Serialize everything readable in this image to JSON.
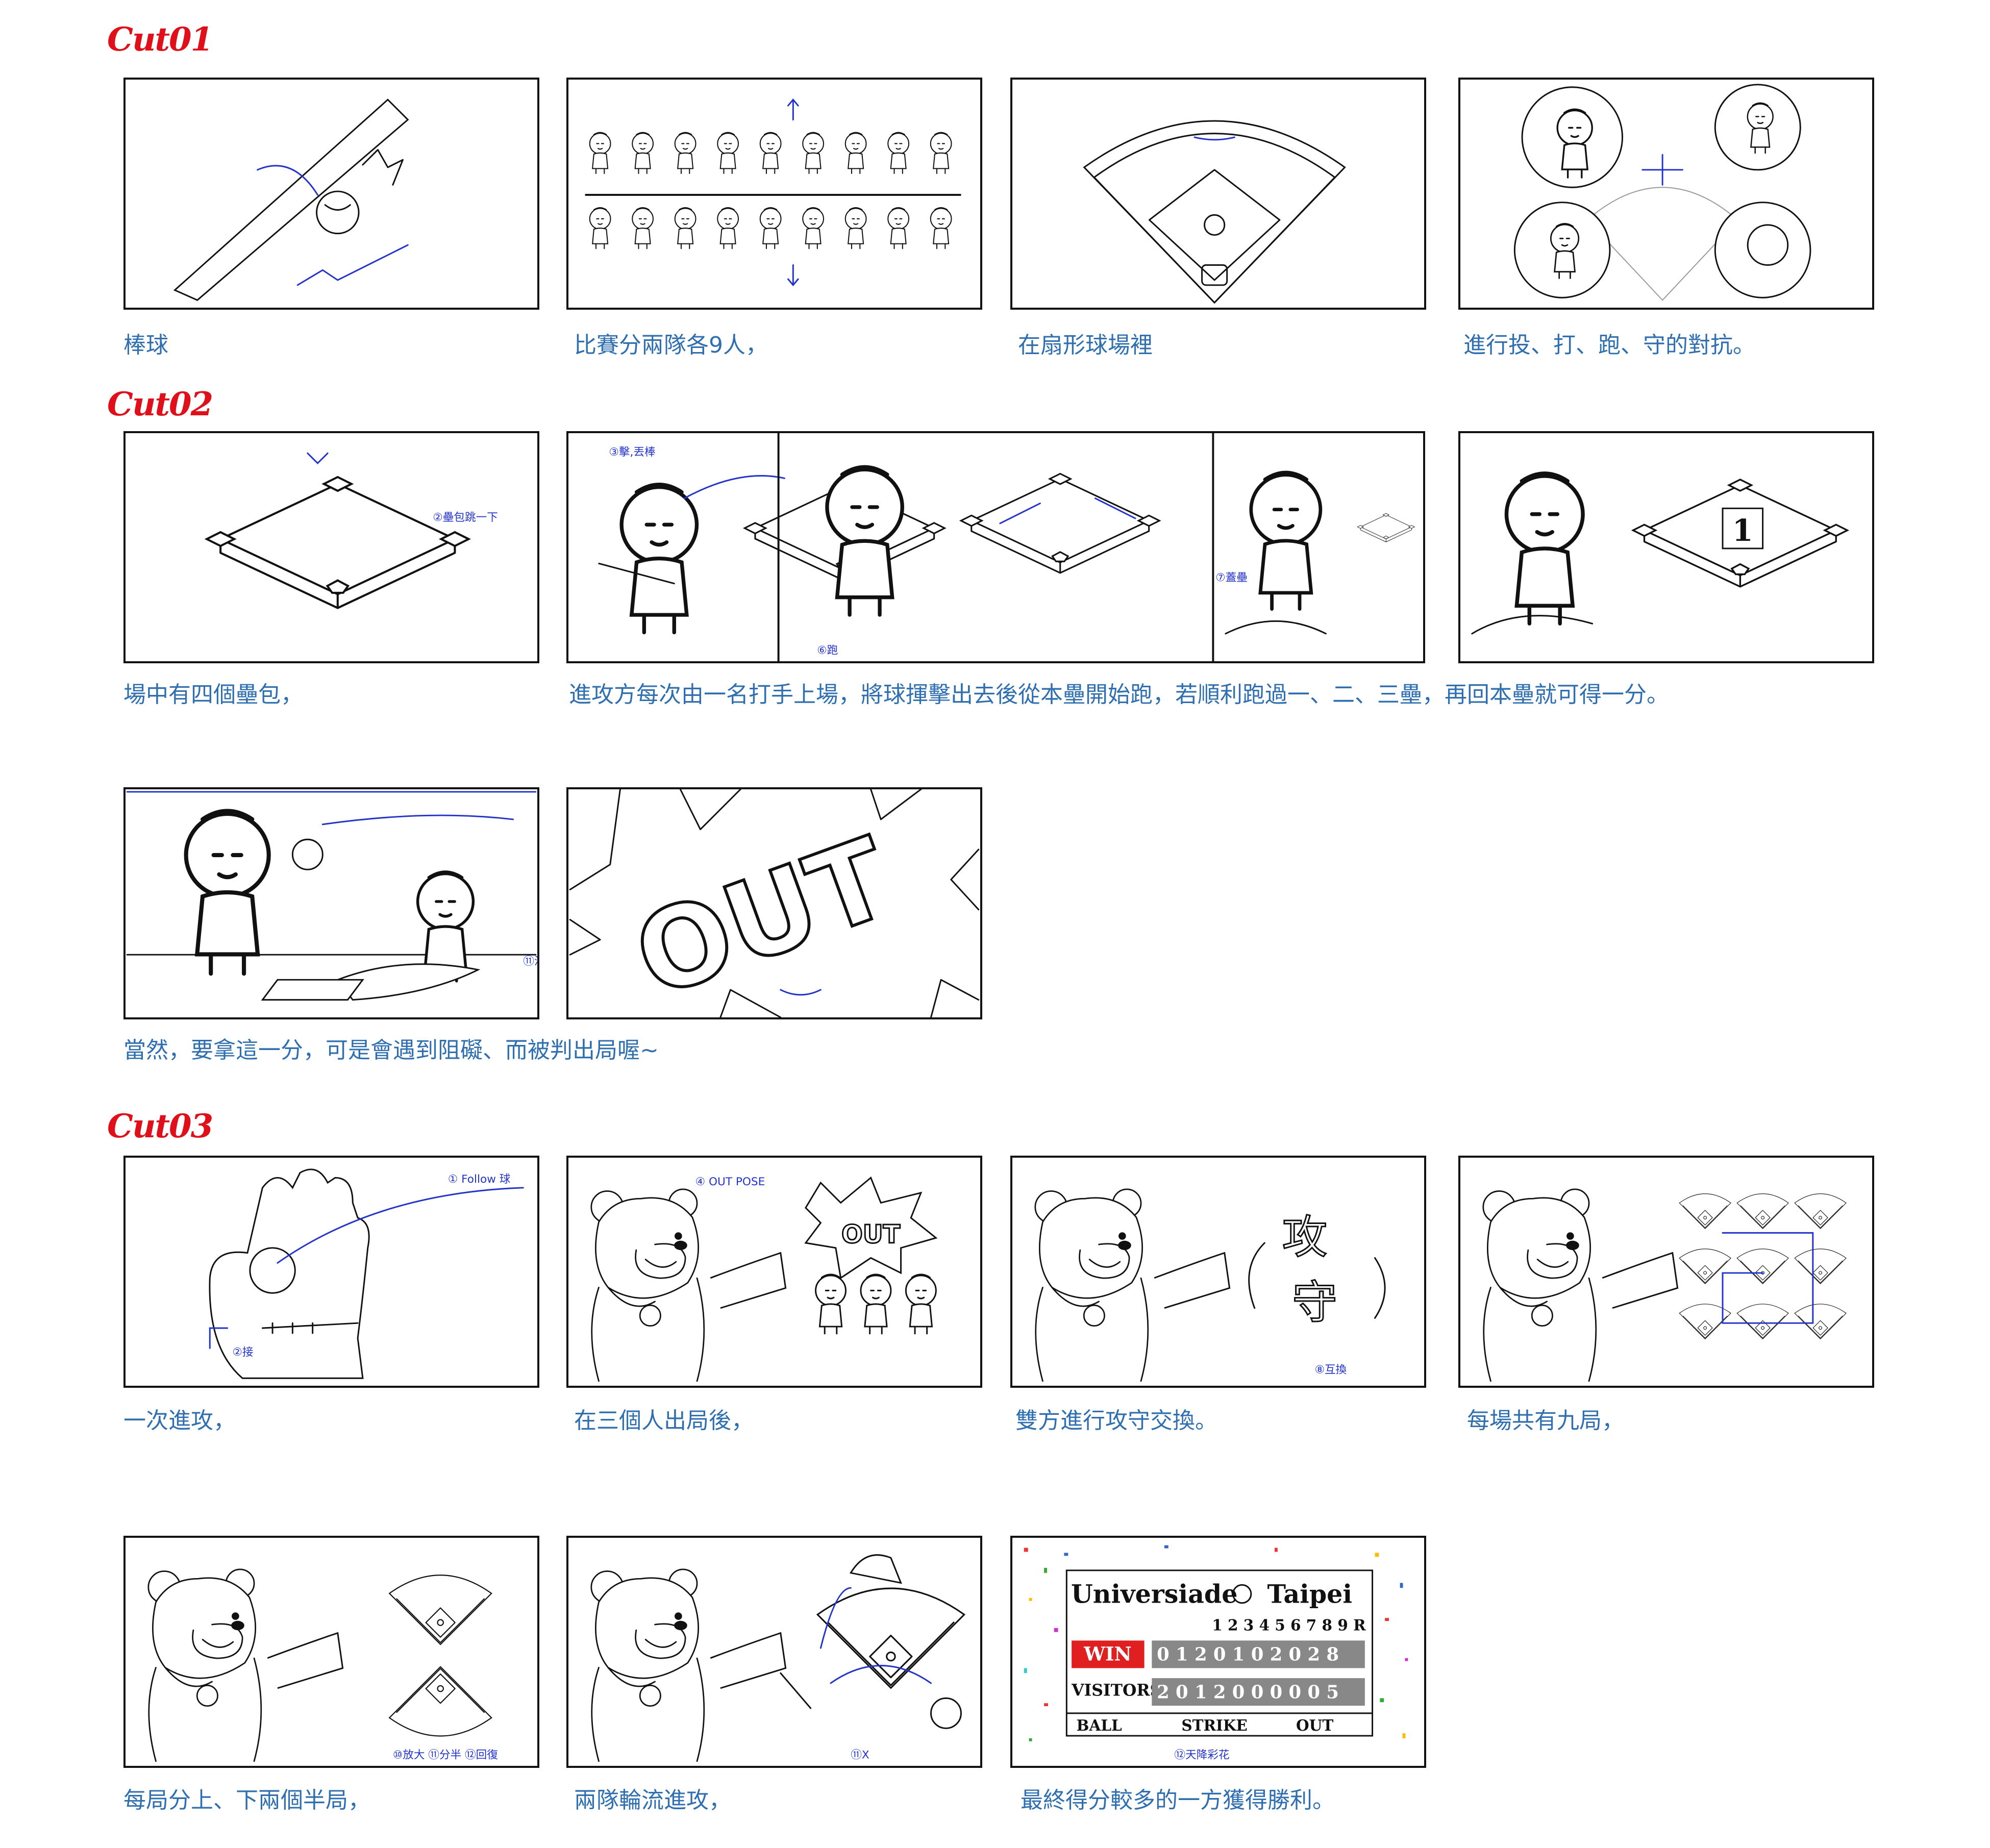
{
  "cuts": [
    {
      "label": "Cut01"
    },
    {
      "label": "Cut02"
    },
    {
      "label": "Cut03"
    }
  ],
  "captions": {
    "c1": "棒球",
    "c2": "比賽分兩隊各9人，",
    "c3": "在扇形球場裡",
    "c4": "進行投、打、跑、守的對抗。",
    "c5": "場中有四個壘包，",
    "c6": "進攻方每次由一名打手上場，將球揮擊出去後從本壘開始跑，若順利跑過一、二、三壘，再回本壘就可得一分。",
    "c7": "當然，要拿這一分，可是會遇到阻礙、而被判出局喔~",
    "c8": "一次進攻，",
    "c9": "在三個人出局後，",
    "c10": "雙方進行攻守交換。",
    "c11": "每場共有九局，",
    "c12": "每局分上、下兩個半局，",
    "c13": "兩隊輪流進攻，",
    "c14": "最終得分較多的一方獲得勝利。"
  },
  "panel_text": {
    "out": "OUT",
    "base_number": "1",
    "gong": "攻",
    "shou": "守",
    "annot_base_bump": "②壘包跳一下",
    "annot_swing": "③擊,丟棒",
    "annot_run": "⑥跑",
    "annot_step": "⑦蓋壘",
    "annot_slide": "⑪滑壘",
    "annot_follow": "① Follow 球",
    "annot_grab": "②接",
    "annot_outpose": "④ OUT POSE",
    "annot_swap": "⑧互換",
    "annot_zoom": "⑩放大 ⑪分半 ⑫回復",
    "annot_x": "⑪X",
    "annot_confetti": "⑫天降彩花"
  },
  "scoreboard": {
    "title_left": "Universiade",
    "title_right": "Taipei",
    "innings_header": "1 2 3 4 5 6 7 8 9 R",
    "win_label": "WIN",
    "home_scores": "0 1 2 0 1 0 2 0 2 8",
    "visitors_label": "VISITORS",
    "visitor_scores": "2 0 1 2 0 0 0 0 0 5",
    "ball_label": "BALL",
    "strike_label": "STRIKE",
    "out_label": "OUT"
  }
}
